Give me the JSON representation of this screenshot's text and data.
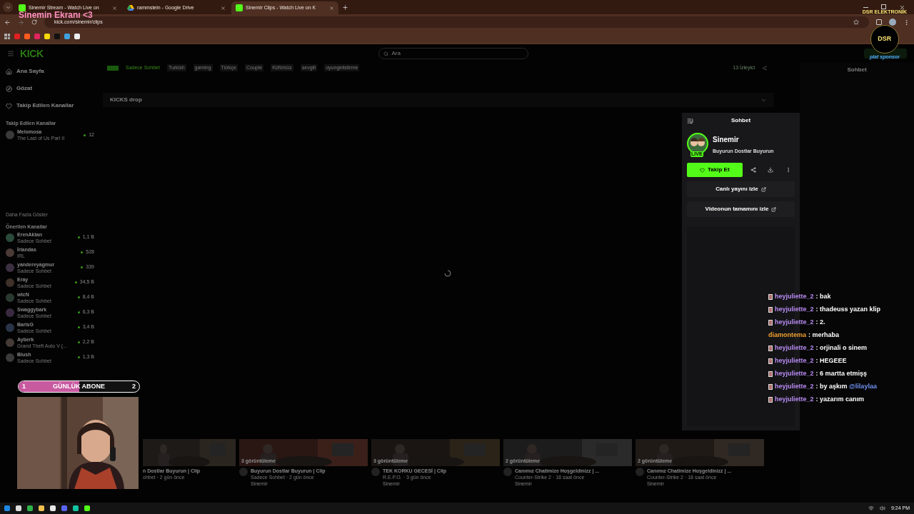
{
  "overlay": {
    "title": "Sinemin Ekranı <3",
    "sponsor": "DSR ELEKTRONİK",
    "sponsor_badge": "DSR",
    "sponsor_tag": "plat sponsor"
  },
  "browser": {
    "tabs": [
      {
        "title": "Sinemir Stream - Watch Live on",
        "selected": false,
        "kind": "kick"
      },
      {
        "title": "rammstein - Google Drive",
        "selected": false,
        "kind": "drive"
      },
      {
        "title": "Sinemir Clips - Watch Live on K",
        "selected": true,
        "kind": "kick"
      }
    ],
    "url": "kick.com/sinemir/clips"
  },
  "site": {
    "logo": "KICK",
    "search": {
      "placeholder": "Ara"
    },
    "nav": [
      "Ana Sayfa",
      "Gözat",
      "Takip Edilen Kanallar"
    ],
    "followed_heading": "Takip Edilen Kanallar",
    "followed": [
      {
        "name": "Melomosa",
        "category": "The Last of Us Part II",
        "viewers": "12"
      }
    ],
    "show_more": "Daha Fazla Göster",
    "recommended_heading": "Önerilen Kanallar",
    "recommended": [
      {
        "name": "ErenAktan",
        "category": "Sadece Sohbet",
        "viewers": "1,1 B"
      },
      {
        "name": "İrlandas",
        "category": "IRL",
        "viewers": "528"
      },
      {
        "name": "yandereyagmur",
        "category": "Sadece Sohbet",
        "viewers": "339"
      },
      {
        "name": "Eray",
        "category": "Sadece Sohbet",
        "viewers": "34,5 B"
      },
      {
        "name": "wtcN",
        "category": "Sadece Sohbet",
        "viewers": "8,4 B"
      },
      {
        "name": "Swaggybark",
        "category": "Sadece Sohbet",
        "viewers": "6,3 B"
      },
      {
        "name": "BarisG",
        "category": "Sadece Sohbet",
        "viewers": "3,4 B"
      },
      {
        "name": "Ayberk",
        "category": "Grand Theft Auto V (...",
        "viewers": "2,2 B"
      },
      {
        "name": "Blush",
        "category": "Sadece Sohbet",
        "viewers": "1,3 B"
      }
    ],
    "tags": [
      "Sadece Sohbet",
      "Turkish",
      "gaming",
      "Türkçe",
      "Couple",
      "Küfürsüz",
      "sevgili",
      "oyungelistirme"
    ],
    "viewers": "13 İzleyici",
    "drop": "KICKS drop",
    "chat_title": "Sohbet"
  },
  "clip_panel": {
    "title": "Sohbet",
    "channel": "Sinemir",
    "subtitle": "Buyurun Dostlar Buyurun",
    "live": "LIVE",
    "follow": "Takip Et",
    "links": [
      "Canlı yayını izle",
      "Videonun tamamını izle"
    ]
  },
  "clips": [
    {
      "title": "n Dostlar Buyurun | Clip",
      "meta": "ohbet · 2 gün önce"
    },
    {
      "views": "3 görüntüleme",
      "title": "Buyurun Dostlar Buyurun | Clip",
      "meta": "Sadece Sohbet · 2 gün önce",
      "channel": "Sinemir"
    },
    {
      "views": "3 görüntüleme",
      "title": "TEK KORKU GECESİ | Clip",
      "meta": "R.E.P.O. · 3 gün önce",
      "channel": "Sinemir"
    },
    {
      "views": "2 görüntüleme",
      "title": "Canımız Chatimize Hoşgeldinizz | ...",
      "meta": "Counter-Strike 2 · 18 saat önce",
      "channel": "Sinemir"
    },
    {
      "views": "2 görüntüleme",
      "title": "Canımız Chatimize Hoşgeldinizz | ...",
      "meta": "Counter-Strike 2 · 18 saat önce",
      "channel": "Sinemir"
    }
  ],
  "sub_goal": {
    "current": "1",
    "label": "GÜNLÜK ABONE",
    "target": "2",
    "level": 0.5
  },
  "chat": [
    {
      "user": "heyjuliette_2",
      "sep": ":",
      "text": "bak",
      "badge": true,
      "color": "#b98cf5"
    },
    {
      "user": "heyjuliette_2",
      "sep": ":",
      "text": "thadeuss yazan klip",
      "badge": true,
      "color": "#b98cf5"
    },
    {
      "user": "heyjuliette_2",
      "sep": ":",
      "text": "2.",
      "badge": true,
      "color": "#b98cf5"
    },
    {
      "user": "diamontema",
      "sep": ":",
      "text": "merhaba",
      "badge": false,
      "color": "#f0a030"
    },
    {
      "user": "heyjuliette_2",
      "sep": ":",
      "text": "orjinali o sinem",
      "badge": true,
      "color": "#b98cf5"
    },
    {
      "user": "heyjuliette_2",
      "sep": ":",
      "text": "HEGEEE",
      "badge": true,
      "color": "#b98cf5"
    },
    {
      "user": "heyjuliette_2",
      "sep": ":",
      "text": "6 martta etmişş",
      "badge": true,
      "color": "#b98cf5"
    },
    {
      "user": "heyjuliette_2",
      "sep": ":",
      "text": "by aşkım",
      "mention": "@lilaylaa",
      "badge": true,
      "color": "#b98cf5"
    },
    {
      "user": "heyjuliette_2",
      "sep": ":",
      "text": "yazarım canım",
      "badge": true,
      "color": "#b98cf5"
    }
  ],
  "taskbar": {
    "time": "9:24 PM"
  }
}
